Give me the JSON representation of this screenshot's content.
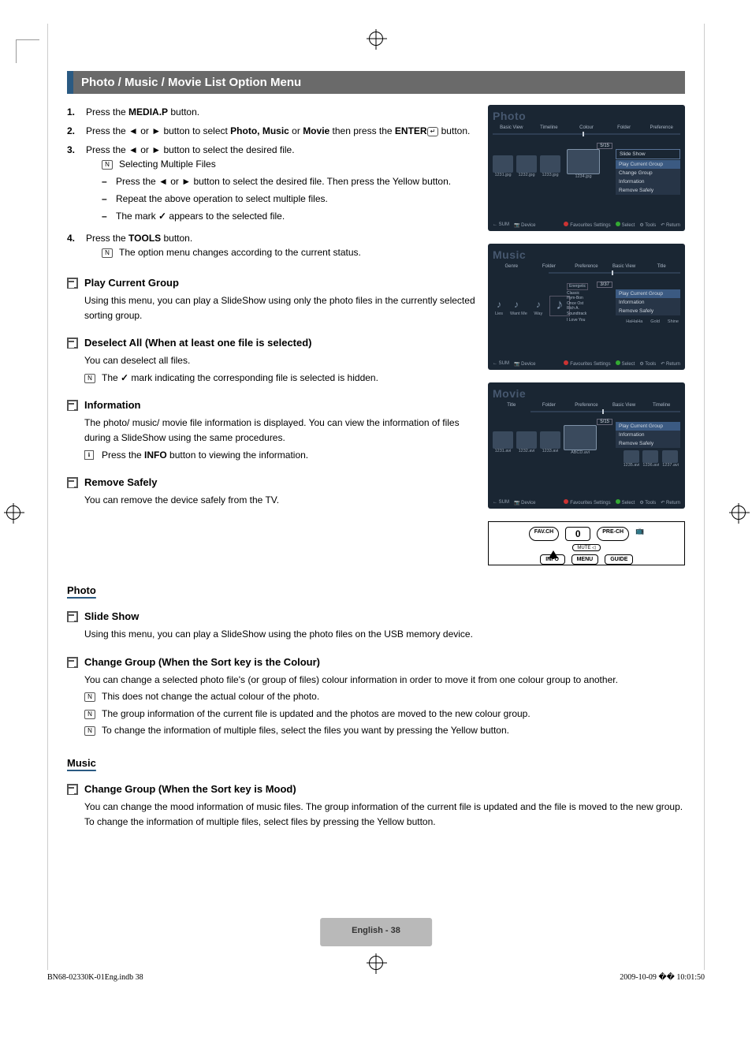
{
  "title": "Photo / Music / Movie List Option Menu",
  "steps": {
    "s1_pre": "Press the ",
    "s1_btn": "MEDIA.P",
    "s1_post": " button.",
    "s2_pre": "Press the ◄ or ► button to select ",
    "s2_b1": "Photo, Music",
    "s2_mid": " or ",
    "s2_b2": "Movie",
    "s2_post": " then press the ",
    "s2_enter": "ENTER",
    "s2_end": " button.",
    "s3": "Press the ◄ or ► button to select the desired file.",
    "s3_note": "Selecting Multiple Files",
    "s3_d1": "Press the ◄ or ► button to select the desired file. Then press the Yellow button.",
    "s3_d2": "Repeat the above operation to select multiple files.",
    "s3_d3_pre": "The mark ",
    "s3_d3_post": " appears to the selected file.",
    "s4_pre": "Press the ",
    "s4_btn": "TOOLS",
    "s4_post": " button.",
    "s4_note": "The option menu changes according to the current status."
  },
  "play_group": {
    "h": "Play Current Group",
    "b": "Using this menu, you can play a SlideShow using only the photo files in the currently selected sorting group."
  },
  "deselect": {
    "h": "Deselect All (When at least one file is selected)",
    "b1": "You can deselect all files.",
    "b2_pre": "The ",
    "b2_post": " mark indicating the corresponding file is selected is hidden."
  },
  "information": {
    "h": "Information",
    "b": "The photo/ music/ movie file information is displayed. You can view the information of files during a SlideShow using the same procedures.",
    "note_pre": "Press the ",
    "note_btn": "INFO",
    "note_post": " button to viewing the information."
  },
  "remove": {
    "h": "Remove Safely",
    "b": "You can remove the device safely from the TV."
  },
  "photo": {
    "head": "Photo",
    "slide_h": "Slide Show",
    "slide_b": "Using this menu, you can play a SlideShow using the photo files on the USB memory device.",
    "cg_h": "Change Group (When the Sort key is the Colour)",
    "cg_b": "You can change a selected photo file's (or group of files) colour information in order to move it from one colour group to another.",
    "cg_n1": "This does not change the actual colour of the photo.",
    "cg_n2": "The group information of the current file is updated and the photos are moved to the new colour group.",
    "cg_n3": "To change the information of multiple files, select the files you want by pressing the Yellow button."
  },
  "music": {
    "head": "Music",
    "cg_h": "Change Group (When the Sort key is Mood)",
    "cg_b": "You can change the mood information of music files. The group information of the current file is updated and the file is moved to the new group. To change the information of multiple files, select files by pressing the Yellow button."
  },
  "ss_photo": {
    "title": "Photo",
    "tabs": [
      "Basic View",
      "Timeline",
      "Colour",
      "Folder",
      "Preference"
    ],
    "count": "5/15",
    "menu": [
      "Slide Show",
      "Play Current Group",
      "Change Group",
      "Information",
      "Remove Safely"
    ],
    "thumbs": [
      "1231.jpg",
      "1232.jpg",
      "1233.jpg",
      "1234.jpg"
    ],
    "foot": [
      "SUM",
      "Device",
      "Favourites Settings",
      "Select",
      "Tools",
      "Return"
    ]
  },
  "ss_music": {
    "title": "Music",
    "tabs": [
      "Genre",
      "Folder",
      "Preference",
      "Basic View",
      "Title"
    ],
    "count": "3/37",
    "menu": [
      "Play Current Group",
      "Information",
      "Remove Safely"
    ],
    "songs_left": [
      "Lies",
      "Want Me",
      "Way"
    ],
    "center_meta": [
      "Energetic",
      "Classic",
      "Hym-Bon",
      "Once Ost",
      "Rich A.",
      "Soundtrack",
      "I Love You"
    ],
    "songs_right": [
      "HaHaHa",
      "Gold",
      "Shine"
    ],
    "foot": [
      "SUM",
      "Device",
      "Favourites Settings",
      "Select",
      "Tools",
      "Return"
    ]
  },
  "ss_movie": {
    "title": "Movie",
    "tabs": [
      "Title",
      "Folder",
      "Preference",
      "Basic View",
      "Timeline"
    ],
    "count": "5/15",
    "menu": [
      "Play Current Group",
      "Information",
      "Remove Safely"
    ],
    "thumbs": [
      "1231.avi",
      "1232.avi",
      "1233.avi",
      "ABCD.avi",
      "1235.avi",
      "1236.avi",
      "1237.avi"
    ],
    "foot": [
      "SUM",
      "Device",
      "Favourites Settings",
      "Select",
      "Tools",
      "Return"
    ]
  },
  "remote": {
    "favch": "FAV.CH",
    "zero": "0",
    "prech": "PRE-CH",
    "tiny": "",
    "info": "INFO",
    "menu": "MENU",
    "guide": "GUIDE"
  },
  "page_num": "English - 38",
  "foot_left": "BN68-02330K-01Eng.indb   38",
  "foot_right": "2009-10-09   �� 10:01:50"
}
